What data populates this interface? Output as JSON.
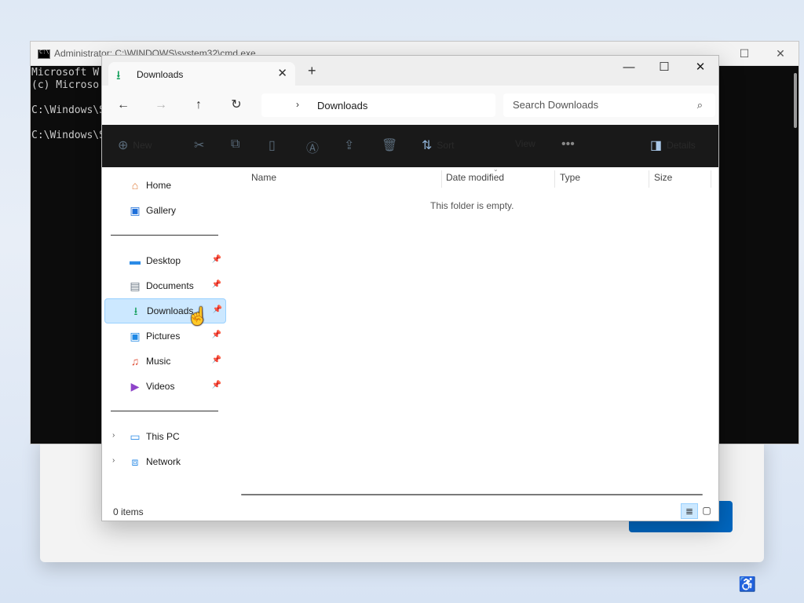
{
  "cmd": {
    "title": "Administrator: C:\\WINDOWS\\system32\\cmd.exe",
    "lines": [
      "Microsoft W",
      "(c) Microso",
      "",
      "C:\\Windows\\S",
      "",
      "C:\\Windows\\S"
    ]
  },
  "explorer": {
    "tab": {
      "label": "Downloads",
      "icon": "download-arrow-icon"
    },
    "address": {
      "crumb": "Downloads"
    },
    "search": {
      "placeholder": "Search Downloads"
    },
    "commandbar": {
      "new_label": "New",
      "sort_label": "Sort",
      "view_label": "View",
      "details_label": "Details"
    },
    "nav": {
      "home": "Home",
      "gallery": "Gallery",
      "desktop": "Desktop",
      "documents": "Documents",
      "downloads": "Downloads",
      "pictures": "Pictures",
      "music": "Music",
      "videos": "Videos",
      "this_pc": "This PC",
      "network": "Network"
    },
    "columns": [
      "Name",
      "Date modified",
      "Type",
      "Size"
    ],
    "empty_message": "This folder is empty.",
    "status": {
      "items": "0 items"
    }
  },
  "colors": {
    "accent": "#0067c0",
    "selection": "#cce8ff",
    "cmd_bg": "#0c0c0c"
  }
}
